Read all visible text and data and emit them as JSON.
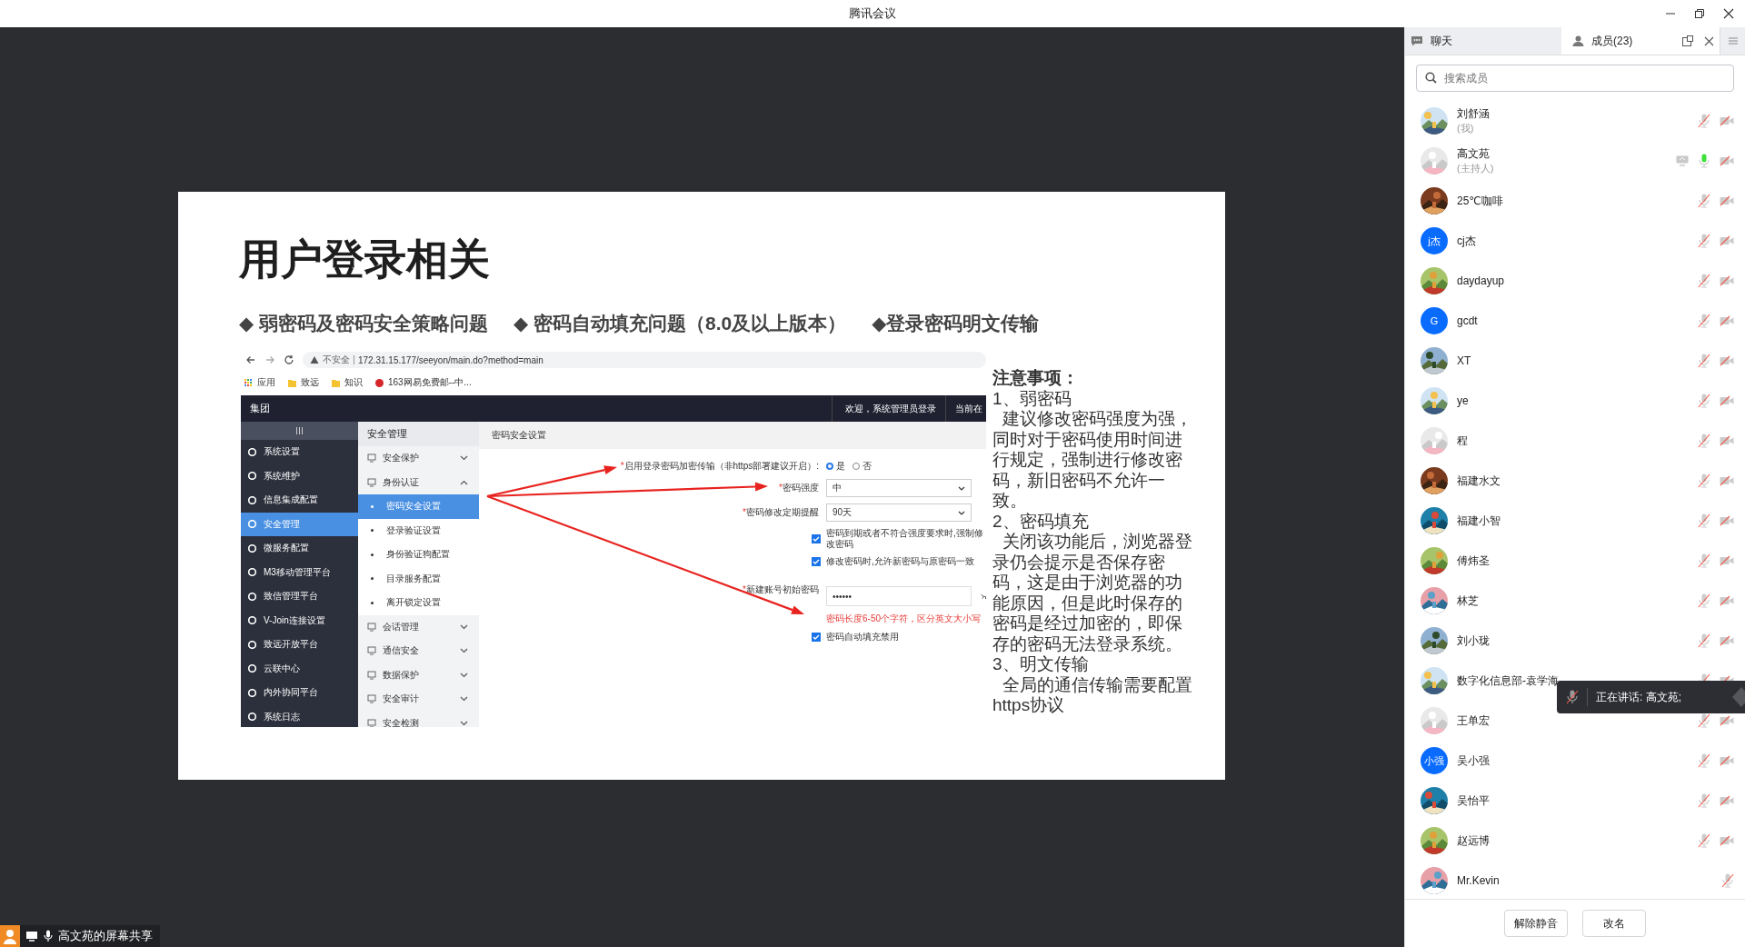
{
  "window": {
    "title": "腾讯会议"
  },
  "slide": {
    "title": "用户登录相关",
    "bullets": [
      "◆ 弱密码及密码安全策略问题",
      "◆ 密码自动填充问题（8.0及以上版本）",
      "◆登录密码明文传输"
    ],
    "screenshot": {
      "browser": {
        "security": "不安全",
        "url": "172.31.15.177/seeyon/main.do?method=main",
        "bookmarks": [
          {
            "label": "应用",
            "kind": "apps"
          },
          {
            "label": "致远",
            "kind": "folder"
          },
          {
            "label": "知识",
            "kind": "folder"
          },
          {
            "label": "163网易免费邮--中...",
            "kind": "mail"
          }
        ]
      },
      "header": {
        "title": "集团",
        "welcome": "欢迎，系统管理员登录",
        "current": "当前在"
      },
      "nav": [
        {
          "label": "系统设置",
          "selected": false
        },
        {
          "label": "系统维护",
          "selected": false
        },
        {
          "label": "信息集成配置",
          "selected": false
        },
        {
          "label": "安全管理",
          "selected": true
        },
        {
          "label": "微服务配置",
          "selected": false
        },
        {
          "label": "M3移动管理平台",
          "selected": false
        },
        {
          "label": "致信管理平台",
          "selected": false
        },
        {
          "label": "V-Join连接设置",
          "selected": false
        },
        {
          "label": "致远开放平台",
          "selected": false
        },
        {
          "label": "云联中心",
          "selected": false
        },
        {
          "label": "内外协同平台",
          "selected": false
        },
        {
          "label": "系统日志",
          "selected": false
        }
      ],
      "menu": {
        "title": "安全管理",
        "groups": [
          {
            "label": "安全保护",
            "expanded": false
          },
          {
            "label": "身份认证",
            "expanded": true,
            "children": [
              {
                "label": "密码安全设置",
                "selected": true
              },
              {
                "label": "登录验证设置",
                "selected": false
              },
              {
                "label": "身份验证狗配置",
                "selected": false
              },
              {
                "label": "目录服务配置",
                "selected": false
              },
              {
                "label": "离开锁定设置",
                "selected": false
              }
            ]
          },
          {
            "label": "会话管理",
            "expanded": false
          },
          {
            "label": "通信安全",
            "expanded": false
          },
          {
            "label": "数据保护",
            "expanded": false
          },
          {
            "label": "安全审计",
            "expanded": false
          },
          {
            "label": "安全检测",
            "expanded": false
          }
        ]
      },
      "page": {
        "title": "密码安全设置",
        "fields": [
          {
            "kind": "radio",
            "required_mark": "*",
            "label": "启用登录密码加密传输（非https部署建议开启）:",
            "options": [
              {
                "label": "是",
                "selected": true
              },
              {
                "label": "否",
                "selected": false
              }
            ]
          },
          {
            "kind": "select",
            "required_mark": "*",
            "label": "密码强度",
            "value": "中"
          },
          {
            "kind": "select",
            "required_mark": "*",
            "label": "密码修改定期提醒",
            "value": "90天"
          },
          {
            "kind": "checkbox",
            "label": "密码到期或者不符合强度要求时,强制修改密码",
            "checked": true
          },
          {
            "kind": "checkbox",
            "label": "修改密码时,允许新密码与原密码一致",
            "checked": true
          },
          {
            "kind": "password",
            "required_mark": "*",
            "label": "新建账号初始密码",
            "value": "••••••",
            "hint": "密码长度6-50个字符，区分英文大小写"
          },
          {
            "kind": "checkbox",
            "label": "密码自动填充禁用",
            "checked": true
          }
        ]
      }
    },
    "notes": [
      {
        "kind": "heading",
        "text": "注意事项："
      },
      {
        "kind": "item",
        "text": "1、弱密码"
      },
      {
        "kind": "body",
        "text": "建议修改密码强度为强，同时对于密码使用时间进行规定，强制进行修改密码，新旧密码不允许一致。"
      },
      {
        "kind": "item",
        "text": "2、密码填充"
      },
      {
        "kind": "body",
        "text": "关闭该功能后，浏览器登录仍会提示是否保存密码，这是由于浏览器的功能原因，但是此时保存的密码是经过加密的，即保存的密码无法登录系统。"
      },
      {
        "kind": "item",
        "text": "3、明文传输"
      },
      {
        "kind": "body",
        "text": "全局的通信传输需要配置https协议"
      }
    ]
  },
  "share_indicator": "高文苑的屏幕共享",
  "tabs": [
    {
      "label": "聊天",
      "kind": "chat",
      "selected": false
    },
    {
      "label": "成员(23)",
      "kind": "members",
      "selected": true
    }
  ],
  "search": {
    "placeholder": "搜索成员"
  },
  "members": [
    {
      "name": "刘舒涵",
      "role": "(我)",
      "sharing": false,
      "muted": true,
      "camera_off": true
    },
    {
      "name": "高文苑",
      "role": "(主持人)",
      "sharing": true,
      "muted": false,
      "camera_off": true
    },
    {
      "name": "25℃咖啡",
      "sharing": false,
      "muted": true,
      "camera_off": true
    },
    {
      "name": "cj杰",
      "avatar": {
        "kind": "letter",
        "text": "j杰"
      },
      "sharing": false,
      "muted": true,
      "camera_off": true
    },
    {
      "name": "daydayup",
      "sharing": false,
      "muted": true,
      "camera_off": true
    },
    {
      "name": "gcdt",
      "avatar": {
        "kind": "letter",
        "text": "G"
      },
      "sharing": false,
      "muted": true,
      "camera_off": true
    },
    {
      "name": "XT",
      "sharing": false,
      "muted": true,
      "camera_off": true
    },
    {
      "name": "ye",
      "sharing": false,
      "muted": true,
      "camera_off": true
    },
    {
      "name": "程",
      "sharing": false,
      "muted": true,
      "camera_off": true
    },
    {
      "name": "福建水文",
      "sharing": false,
      "muted": true,
      "camera_off": true
    },
    {
      "name": "福建小智",
      "sharing": false,
      "muted": true,
      "camera_off": true
    },
    {
      "name": "傅炜圣",
      "sharing": false,
      "muted": true,
      "camera_off": true
    },
    {
      "name": "林芝",
      "sharing": false,
      "muted": true,
      "camera_off": true
    },
    {
      "name": "刘小珑",
      "sharing": false,
      "muted": true,
      "camera_off": true
    },
    {
      "name": "数字化信息部-袁学海",
      "sharing": false,
      "muted": true,
      "camera_off": true
    },
    {
      "name": "王单宏",
      "sharing": false,
      "muted": true,
      "camera_off": true
    },
    {
      "name": "吴小强",
      "avatar": {
        "kind": "letter",
        "text": "小强"
      },
      "sharing": false,
      "muted": true,
      "camera_off": true
    },
    {
      "name": "吴怡平",
      "sharing": false,
      "muted": true,
      "camera_off": true
    },
    {
      "name": "赵远博",
      "sharing": false,
      "muted": true,
      "camera_off": true
    },
    {
      "name": "Mr.Kevin",
      "sharing": false,
      "muted": true
    }
  ],
  "speaking_tooltip": "正在讲话: 高文苑;",
  "buttons": [
    "解除静音",
    "改名"
  ]
}
